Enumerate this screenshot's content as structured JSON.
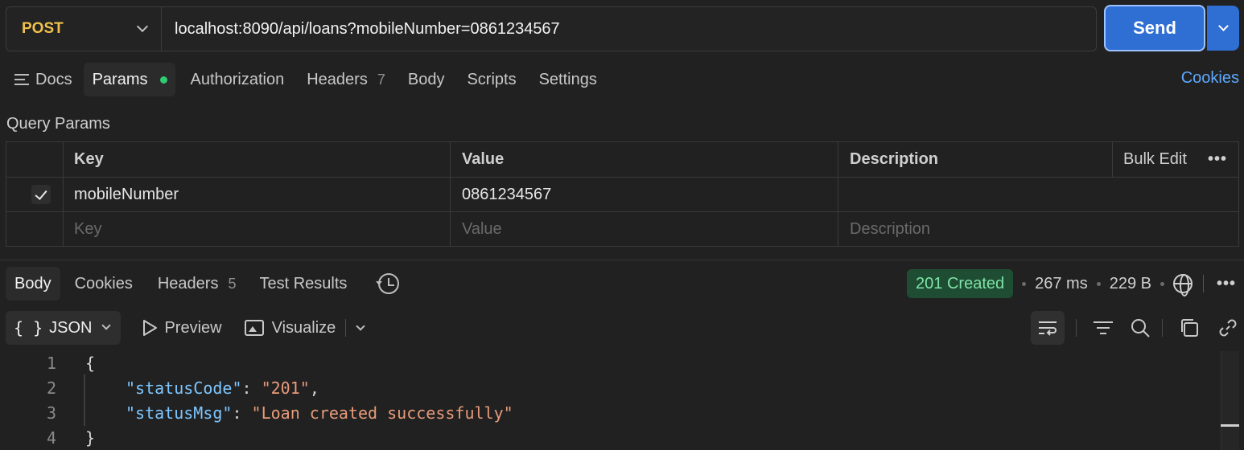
{
  "request": {
    "method": "POST",
    "url": "localhost:8090/api/loans?mobileNumber=0861234567",
    "send_label": "Send"
  },
  "request_tabs": {
    "docs": "Docs",
    "params": "Params",
    "authorization": "Authorization",
    "headers": "Headers",
    "headers_count": "7",
    "body": "Body",
    "scripts": "Scripts",
    "settings": "Settings",
    "cookies_link": "Cookies"
  },
  "query_params": {
    "title": "Query Params",
    "columns": {
      "key": "Key",
      "value": "Value",
      "description": "Description",
      "bulk_edit": "Bulk Edit"
    },
    "rows": [
      {
        "checked": true,
        "key": "mobileNumber",
        "value": "0861234567",
        "description": ""
      }
    ],
    "placeholders": {
      "key": "Key",
      "value": "Value",
      "description": "Description"
    }
  },
  "response_tabs": {
    "body": "Body",
    "cookies": "Cookies",
    "headers": "Headers",
    "headers_count": "5",
    "test_results": "Test Results"
  },
  "response_meta": {
    "status": "201 Created",
    "time": "267 ms",
    "size": "229 B",
    "status_color": "#7fe3a6"
  },
  "body_toolbar": {
    "format": "JSON",
    "format_glyph": "{ }",
    "preview": "Preview",
    "visualize": "Visualize"
  },
  "code": {
    "lines": [
      "1",
      "2",
      "3",
      "4"
    ],
    "open_brace": "{",
    "close_brace": "}",
    "l2_key": "\"statusCode\"",
    "l2_value": "\"201\"",
    "l3_key": "\"statusMsg\"",
    "l3_value": "\"Loan created successfully\"",
    "colon": ": ",
    "comma": ","
  },
  "icons": [
    "chevron-down-icon",
    "docs-icon",
    "check-icon",
    "more-icon",
    "history-icon",
    "globe-icon",
    "play-icon",
    "image-icon",
    "wrap-icon",
    "filter-icon",
    "search-icon",
    "copy-icon",
    "link-icon"
  ]
}
